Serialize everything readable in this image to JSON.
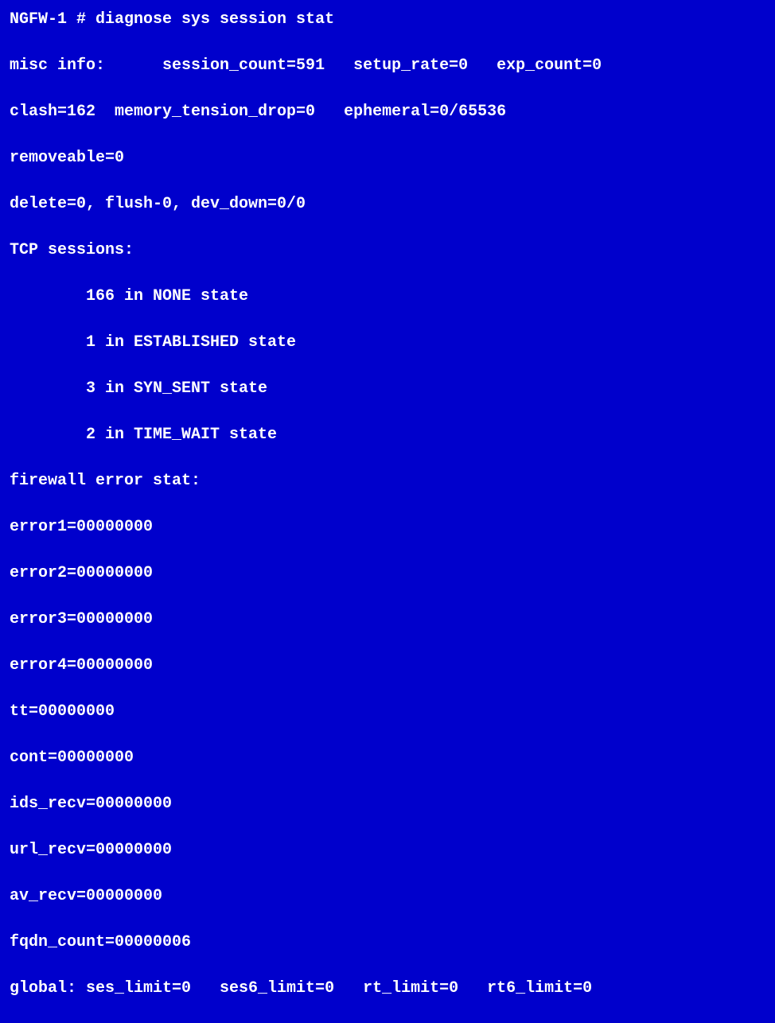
{
  "terminal": {
    "lines": [
      "NGFW-1 # diagnose sys session stat",
      "misc info:      session_count=591   setup_rate=0   exp_count=0",
      "clash=162  memory_tension_drop=0   ephemeral=0/65536",
      "removeable=0",
      "delete=0, flush-0, dev_down=0/0",
      "TCP sessions:",
      "        166 in NONE state",
      "        1 in ESTABLISHED state",
      "        3 in SYN_SENT state",
      "        2 in TIME_WAIT state",
      "firewall error stat:",
      "error1=00000000",
      "error2=00000000",
      "error3=00000000",
      "error4=00000000",
      "tt=00000000",
      "cont=00000000",
      "ids_recv=00000000",
      "url_recv=00000000",
      "av_recv=00000000",
      "fqdn_count=00000006",
      "global: ses_limit=0   ses6_limit=0   rt_limit=0   rt6_limit=0"
    ]
  }
}
